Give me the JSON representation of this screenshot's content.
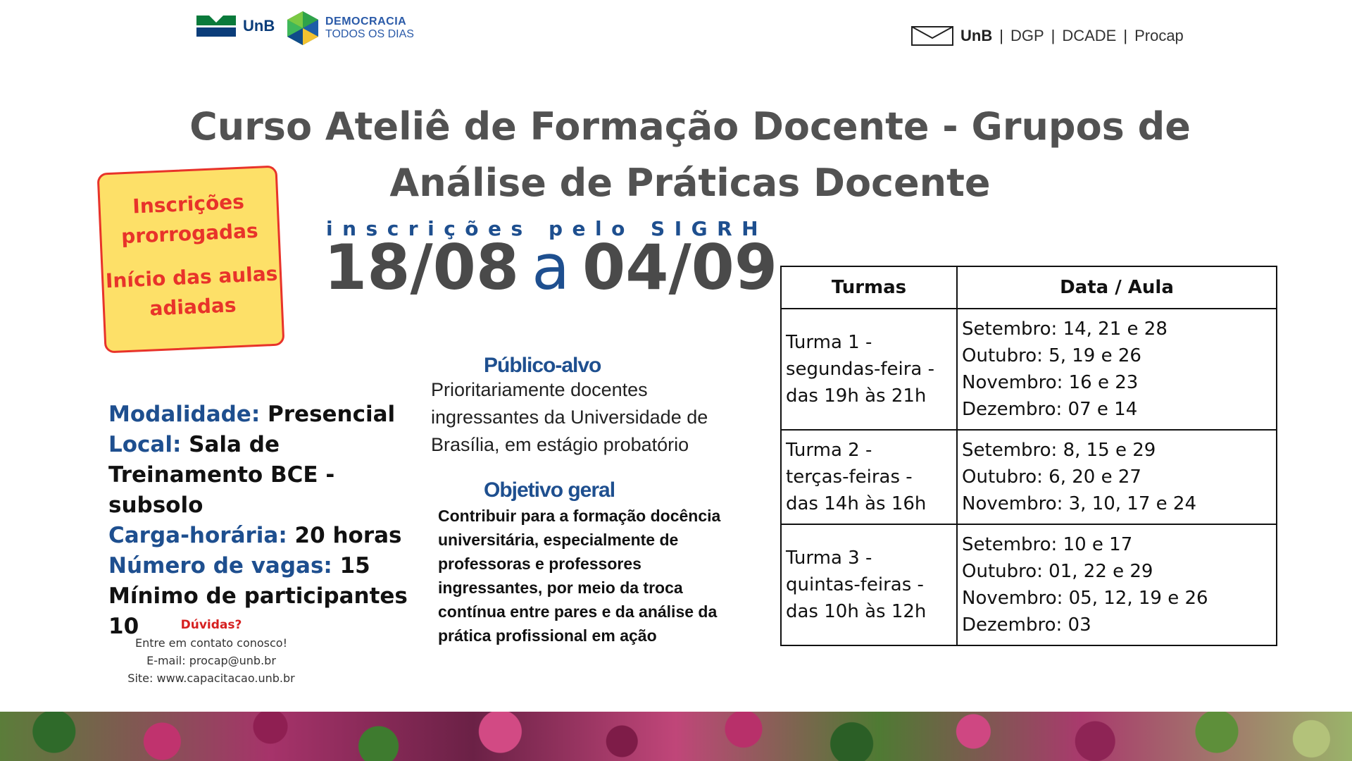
{
  "header": {
    "unb_left": "UnB",
    "democracia_line1": "DEMOCRACIA",
    "democracia_line2": "TODOS OS DIAS",
    "right_unb": "UnB",
    "right_dgp": "DGP",
    "right_dcade": "DCADE",
    "right_procap": "Procap",
    "separator": "|"
  },
  "title": {
    "line1": "Curso Ateliê de Formação Docente - Grupos de",
    "line2": "Análise de Práticas Docente"
  },
  "notice": {
    "line1": "Inscrições prorrogadas",
    "line2": "Início das aulas adiadas"
  },
  "inscricoes": {
    "label": "inscrições pelo SIGRH",
    "start": "18/08",
    "connector": "a",
    "end": "04/09"
  },
  "info": {
    "modalidade_key": "Modalidade:",
    "modalidade_val": "Presencial",
    "local_key": "Local:",
    "local_val": "Sala de Treinamento BCE - subsolo",
    "carga_key": "Carga-horária:",
    "carga_val": "20 horas",
    "vagas_key": "Número de vagas:",
    "vagas_val": "15",
    "minimo": "Mínimo de participantes 10"
  },
  "publico": {
    "heading": "Público-alvo",
    "text": "Prioritariamente docentes ingressantes da Universidade de Brasília, em estágio probatório"
  },
  "objetivo": {
    "heading": "Objetivo geral",
    "text": "Contribuir para a formação docência universitária, especialmente de professoras e professores ingressantes, por meio da troca contínua entre pares e da análise da prática profissional em ação"
  },
  "contact": {
    "heading": "Dúvidas?",
    "line1": "Entre em contato conosco!",
    "line2": "E-mail: procap@unb.br",
    "line3": "Site: www.capacitacao.unb.br"
  },
  "table": {
    "headers": [
      "Turmas",
      "Data / Aula"
    ],
    "rows": [
      {
        "turma": [
          "Turma 1 -",
          "segundas-feira -",
          "das 19h às 21h"
        ],
        "datas": [
          "Setembro:  14, 21 e 28",
          "Outubro: 5, 19 e 26",
          "Novembro: 16 e 23",
          "Dezembro: 07 e 14"
        ]
      },
      {
        "turma": [
          "Turma 2 -",
          "terças-feiras -",
          "das 14h às 16h"
        ],
        "datas": [
          "Setembro: 8, 15 e 29",
          "Outubro: 6, 20 e 27",
          "Novembro: 3, 10, 17 e 24"
        ]
      },
      {
        "turma": [
          "Turma 3 -",
          "quintas-feiras -",
          "das 10h às 12h"
        ],
        "datas": [
          "Setembro: 10 e 17",
          "Outubro: 01, 22 e 29",
          "Novembro: 05, 12, 19 e 26",
          "Dezembro: 03"
        ]
      }
    ]
  },
  "colors": {
    "title_gray": "#525252",
    "brand_blue": "#1e4f8f",
    "notice_yellow": "#fde068",
    "notice_red": "#e8332a"
  }
}
